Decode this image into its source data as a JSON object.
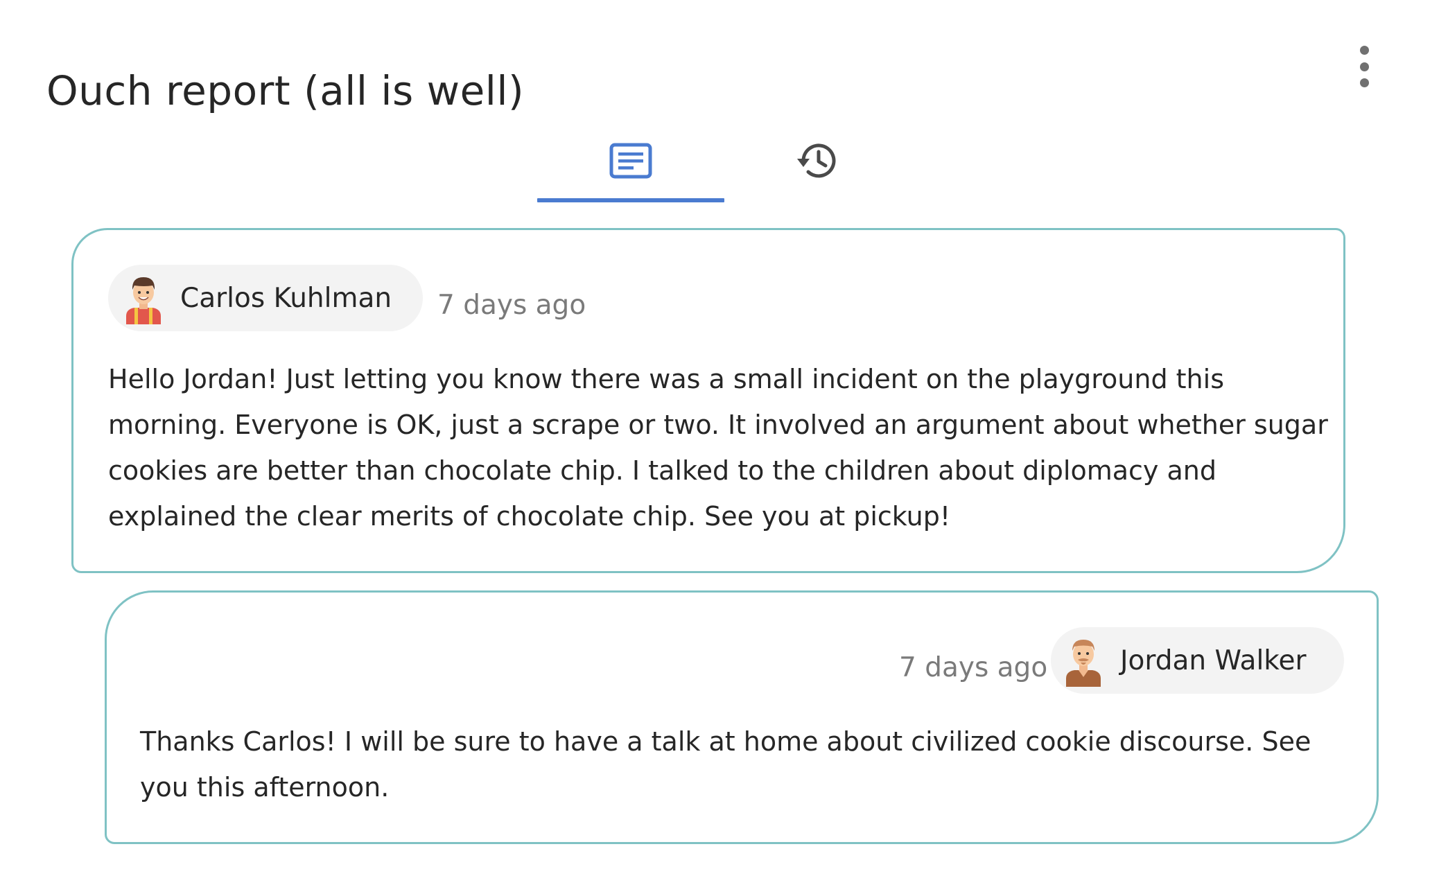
{
  "header": {
    "title": "Ouch report (all is well)",
    "more_menu_icon": "more-vertical-icon"
  },
  "tabs": [
    {
      "icon": "message-icon",
      "active": true
    },
    {
      "icon": "history-icon",
      "active": false
    }
  ],
  "colors": {
    "accent": "#4a7bd0",
    "card_border": "#7fc2c4",
    "chip_background": "#f3f3f3",
    "muted_text": "#7a7a7a",
    "text": "#262626"
  },
  "messages": [
    {
      "author": "Carlos Kuhlman",
      "avatar": "teacher-avatar",
      "timestamp": "7 days ago",
      "text": "Hello Jordan! Just letting you know there was a small incident on the playground this morning. Everyone is OK, just a scrape or two. It involved an argument about whether sugar cookies are better than chocolate chip. I talked to the children about diplomacy and explained the clear merits of chocolate chip. See you at pickup!"
    },
    {
      "author": "Jordan Walker",
      "avatar": "parent-avatar",
      "timestamp": "7 days ago",
      "text": "Thanks Carlos! I will be sure to have a talk at home about civilized cookie discourse. See you this afternoon."
    }
  ]
}
